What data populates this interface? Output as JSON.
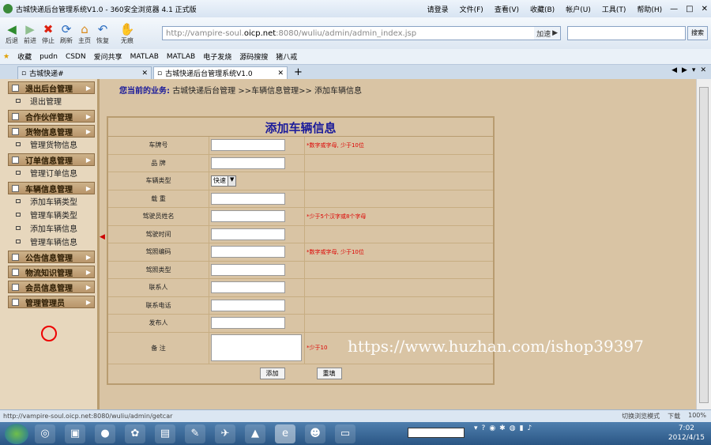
{
  "window": {
    "title": "古城快递后台管理系统V1.0 - 360安全浏览器 4.1 正式版",
    "menus": [
      "请登录",
      "文件(F)",
      "查看(V)",
      "收藏(B)",
      "帐户(U)",
      "工具(T)",
      "帮助(H)"
    ]
  },
  "toolbar": {
    "buttons": [
      "后退",
      "前进",
      "停止",
      "刷新",
      "主页",
      "恢复",
      "无痕"
    ],
    "address_prefix": "http://vampire-soul.",
    "address_domain": "oicp.net",
    "address_suffix": ":8080/wuliu/admin/admin_index.jsp",
    "accelerate": "加速",
    "search_button": "搜索"
  },
  "favorites": [
    "收藏",
    "pudn",
    "CSDN",
    "爱问共享",
    "MATLAB",
    "MATLAB",
    "电子发烧",
    "源码搜搜",
    "猪八戒"
  ],
  "tabs": [
    {
      "label": "古城快递#"
    },
    {
      "label": "古城快递后台管理系统V1.0"
    }
  ],
  "sidebar": [
    {
      "section": "退出后台管理",
      "items": [
        "退出管理"
      ]
    },
    {
      "section": "合作伙伴管理",
      "items": []
    },
    {
      "section": "货物信息管理",
      "items": [
        "管理货物信息"
      ]
    },
    {
      "section": "订单信息管理",
      "items": [
        "管理订单信息"
      ]
    },
    {
      "section": "车辆信息管理",
      "items": [
        "添加车辆类型",
        "管理车辆类型",
        "添加车辆信息",
        "管理车辆信息"
      ]
    },
    {
      "section": "公告信息管理",
      "items": []
    },
    {
      "section": "物流知识管理",
      "items": []
    },
    {
      "section": "会员信息管理",
      "items": []
    },
    {
      "section": "管理管理员",
      "items": []
    }
  ],
  "breadcrumb": {
    "label": "您当前的业务:",
    "path": "古城快递后台管理 >>车辆信息管理>> 添加车辆信息"
  },
  "form": {
    "title": "添加车辆信息",
    "fields": [
      {
        "label": "车牌号",
        "type": "text",
        "hint": "*数字或字母, 少于10位"
      },
      {
        "label": "品 牌",
        "type": "text",
        "hint": ""
      },
      {
        "label": "车辆类型",
        "type": "select",
        "value": "快速",
        "hint": ""
      },
      {
        "label": "载 重",
        "type": "text",
        "hint": ""
      },
      {
        "label": "驾驶员姓名",
        "type": "text",
        "hint": "*少于5个汉字或8个字母"
      },
      {
        "label": "驾驶时间",
        "type": "text",
        "hint": ""
      },
      {
        "label": "驾照编码",
        "type": "text",
        "hint": "*数字或字母, 少于10位"
      },
      {
        "label": "驾照类型",
        "type": "text",
        "hint": ""
      },
      {
        "label": "联系人",
        "type": "text",
        "hint": ""
      },
      {
        "label": "联系电话",
        "type": "text",
        "hint": ""
      },
      {
        "label": "发布人",
        "type": "text",
        "hint": ""
      }
    ],
    "remark_label": "备 注",
    "remark_hint": "*少于10",
    "submit": "添加",
    "reset": "重填"
  },
  "watermark": "https://www.huzhan.com/ishop39397",
  "status": {
    "url": "http://vampire-soul.oicp.net:8080/wuliu/admin/getcar",
    "mode": "切换浏览模式",
    "download": "下载",
    "zoom": "100%"
  },
  "taskbar": {
    "time": "7:02",
    "date": "2012/4/15"
  }
}
